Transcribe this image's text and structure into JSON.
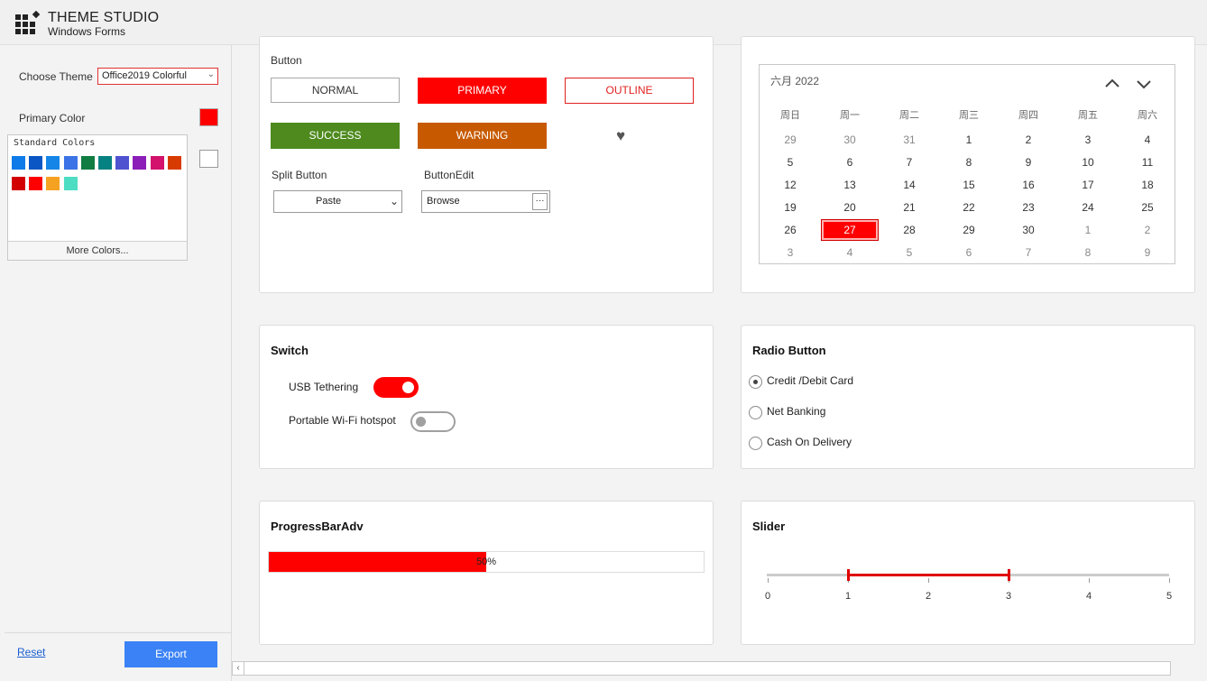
{
  "app": {
    "title": "THEME STUDIO",
    "subtitle": "Windows Forms"
  },
  "left_panel": {
    "choose_theme_label": "Choose Theme",
    "theme_value": "Office2019 Colorful",
    "primary_color_label": "Primary Color",
    "primary_color": "#ff0000",
    "palette_title": "Standard Colors",
    "standard_colors": [
      "#0f7be8",
      "#0a56c4",
      "#1585e8",
      "#3c73e6",
      "#107c41",
      "#078282",
      "#4f53d0",
      "#8b1fb8",
      "#d2126d",
      "#d83b01",
      "#d20000",
      "#ff0000",
      "#f5a223",
      "#4dddc2"
    ],
    "more_colors": "More Colors...",
    "reset": "Reset",
    "export": "Export"
  },
  "buttons_card": {
    "title": "Button",
    "normal": "NORMAL",
    "primary": "PRIMARY",
    "outline": "OUTLINE",
    "success": "SUCCESS",
    "warning": "WARNING",
    "split_button_label": "Split Button",
    "split_button_value": "Paste",
    "button_edit_label": "ButtonEdit",
    "button_edit_value": "Browse",
    "button_edit_dots": "···"
  },
  "calendar": {
    "month": "六月  2022",
    "weekdays": [
      "周日",
      "周一",
      "周二",
      "周三",
      "周四",
      "周五",
      "周六"
    ],
    "weeks": [
      [
        "29",
        "30",
        "31",
        "1",
        "2",
        "3",
        "4"
      ],
      [
        "5",
        "6",
        "7",
        "8",
        "9",
        "10",
        "11"
      ],
      [
        "12",
        "13",
        "14",
        "15",
        "16",
        "17",
        "18"
      ],
      [
        "19",
        "20",
        "21",
        "22",
        "23",
        "24",
        "25"
      ],
      [
        "26",
        "27",
        "28",
        "29",
        "30",
        "1",
        "2"
      ],
      [
        "3",
        "4",
        "5",
        "6",
        "7",
        "8",
        "9"
      ]
    ],
    "selected": "27"
  },
  "switch_card": {
    "title": "Switch",
    "usb_label": "USB Tethering",
    "usb_on": true,
    "wifi_label": "Portable Wi-Fi hotspot",
    "wifi_on": false
  },
  "radio_card": {
    "title": "Radio Button",
    "options": [
      "Credit /Debit Card",
      "Net Banking",
      "Cash On Delivery"
    ],
    "selected_index": 0
  },
  "progress_card": {
    "title": "ProgressBarAdv",
    "value_text": "50%",
    "value": 0.5
  },
  "slider_card": {
    "title": "Slider",
    "ticks": [
      "0",
      "1",
      "2",
      "3",
      "4",
      "5"
    ],
    "range_start": 1,
    "range_end": 3,
    "min": 0,
    "max": 5
  }
}
